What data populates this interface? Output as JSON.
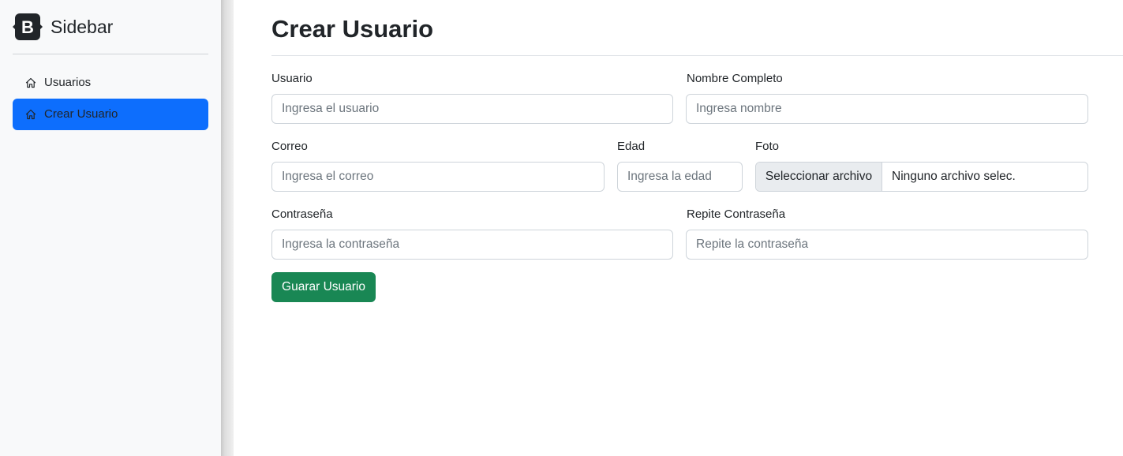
{
  "sidebar": {
    "brand_letter": "B",
    "brand_title": "Sidebar",
    "items": [
      {
        "label": "Usuarios",
        "icon": "house-icon",
        "active": false
      },
      {
        "label": "Crear Usuario",
        "icon": "house-icon",
        "active": true
      }
    ]
  },
  "main": {
    "title": "Crear Usuario",
    "form": {
      "usuario": {
        "label": "Usuario",
        "placeholder": "Ingresa el usuario",
        "value": ""
      },
      "nombre": {
        "label": "Nombre Completo",
        "placeholder": "Ingresa nombre",
        "value": ""
      },
      "correo": {
        "label": "Correo",
        "placeholder": "Ingresa el correo",
        "value": ""
      },
      "edad": {
        "label": "Edad",
        "placeholder": "Ingresa la edad",
        "value": ""
      },
      "foto": {
        "label": "Foto",
        "button_label": "Seleccionar archivo",
        "file_text": "Ninguno archivo selec."
      },
      "contrasena": {
        "label": "Contraseña",
        "placeholder": "Ingresa la contraseña",
        "value": ""
      },
      "repite": {
        "label": "Repite Contraseña",
        "placeholder": "Repite la contraseña",
        "value": ""
      },
      "submit_label": "Guarar Usuario"
    }
  },
  "colors": {
    "primary": "#0d6efd",
    "success": "#198754",
    "sidebar_bg": "#f8f9fa",
    "brand_logo": "#212529"
  }
}
